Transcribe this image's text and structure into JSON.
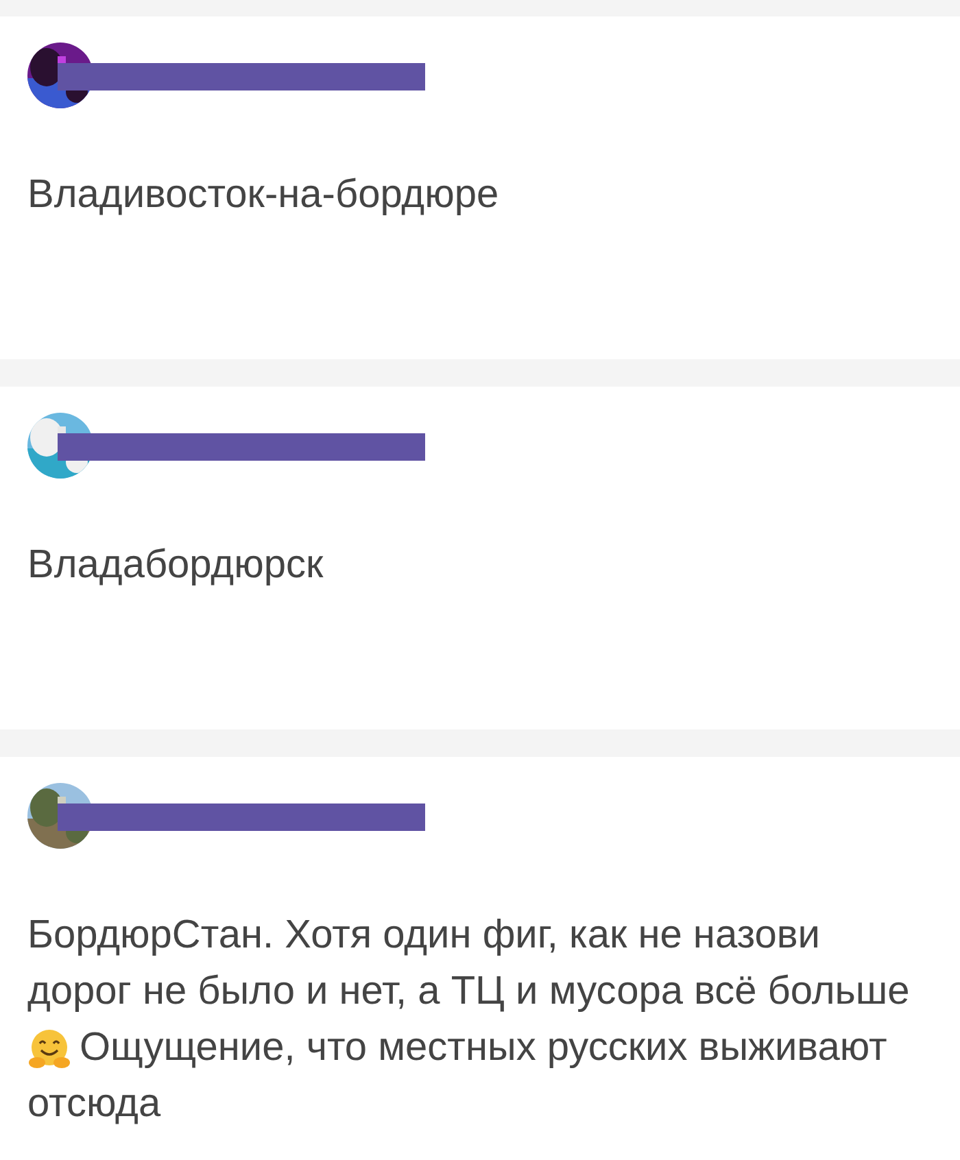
{
  "comments": [
    {
      "author": {
        "redacted": true
      },
      "lines": [
        {
          "text": "Владивосток-на-бордюре",
          "emoji": false
        }
      ]
    },
    {
      "author": {
        "redacted": true
      },
      "lines": [
        {
          "text": "Владабордюрск",
          "emoji": false
        }
      ]
    },
    {
      "author": {
        "redacted": true
      },
      "lines": [
        {
          "text": "БордюрСтан. Хотя один фиг, как не назови",
          "emoji": false
        },
        {
          "text": "дорог не было и нет, а ТЦ и мусора всё больше",
          "emoji": false
        },
        {
          "text": "Ощущение, что местных русских выживают",
          "emoji": true
        },
        {
          "text": "отсюда",
          "emoji": false
        }
      ]
    }
  ]
}
